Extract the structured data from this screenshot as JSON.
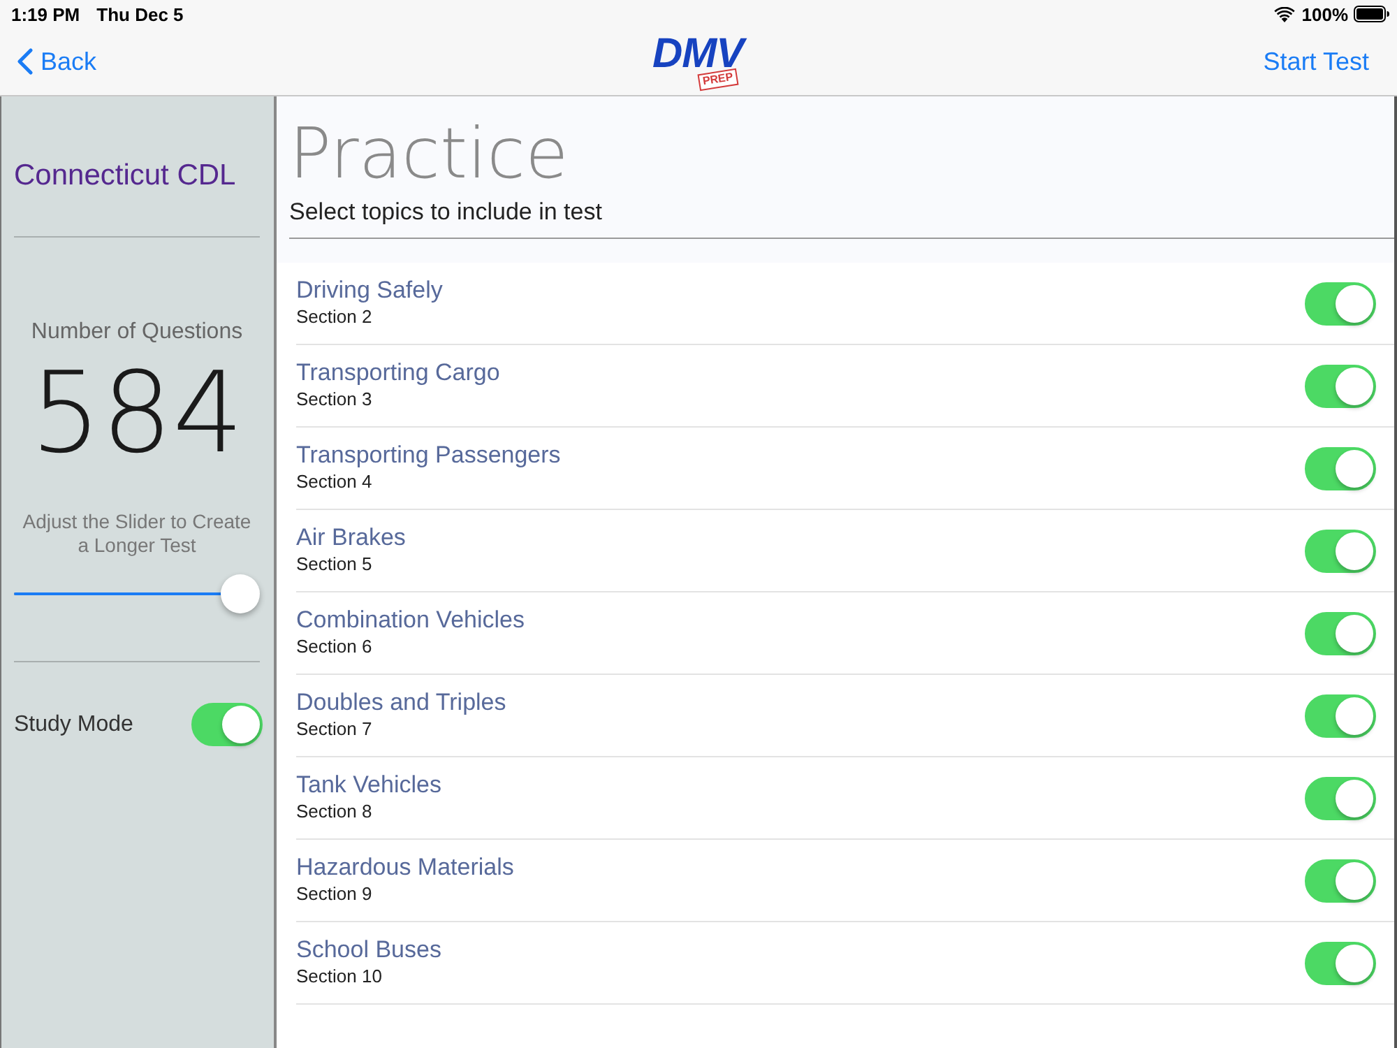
{
  "status_bar": {
    "time": "1:19 PM",
    "date": "Thu Dec 5",
    "battery": "100%"
  },
  "nav_bar": {
    "back": "Back",
    "logo": {
      "text": "DMV",
      "tag": "PREP"
    },
    "action": "Start Test"
  },
  "sidebar": {
    "title": "Connecticut CDL",
    "count_label": "Number of Questions",
    "count": "584",
    "slider_hint": "Adjust the Slider to Create a Longer Test",
    "slider": {
      "level": 1
    },
    "study_mode": {
      "label": "Study Mode",
      "on": true
    }
  },
  "main": {
    "title": "Practice",
    "subtitle": "Select topics to include in test",
    "topics": [
      {
        "name": "Driving Safely",
        "section": "Section 2",
        "on": true
      },
      {
        "name": "Transporting Cargo",
        "section": "Section 3",
        "on": true
      },
      {
        "name": "Transporting Passengers",
        "section": "Section 4",
        "on": true
      },
      {
        "name": "Air Brakes",
        "section": "Section 5",
        "on": true
      },
      {
        "name": "Combination Vehicles",
        "section": "Section 6",
        "on": true
      },
      {
        "name": "Doubles and Triples",
        "section": "Section 7",
        "on": true
      },
      {
        "name": "Tank Vehicles",
        "section": "Section 8",
        "on": true
      },
      {
        "name": "Hazardous Materials",
        "section": "Section 9",
        "on": true
      },
      {
        "name": "School Buses",
        "section": "Section 10",
        "on": true
      }
    ]
  }
}
